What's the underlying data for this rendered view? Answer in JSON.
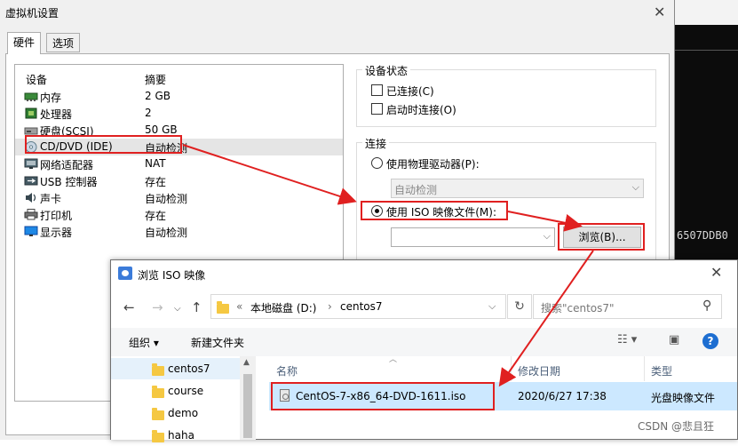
{
  "window": {
    "title": "虚拟机设置"
  },
  "tabs": [
    {
      "label": "硬件"
    },
    {
      "label": "选项"
    }
  ],
  "device_list": {
    "headers": {
      "device": "设备",
      "summary": "摘要"
    },
    "rows": [
      {
        "name": "内存",
        "summary": "2 GB",
        "icon": "memory-icon"
      },
      {
        "name": "处理器",
        "summary": "2",
        "icon": "cpu-icon"
      },
      {
        "name": "硬盘(SCSI)",
        "summary": "50 GB",
        "icon": "harddisk-icon"
      },
      {
        "name": "CD/DVD (IDE)",
        "summary": "自动检测",
        "icon": "cdrom-icon"
      },
      {
        "name": "网络适配器",
        "summary": "NAT",
        "icon": "network-icon"
      },
      {
        "name": "USB 控制器",
        "summary": "存在",
        "icon": "usb-icon"
      },
      {
        "name": "声卡",
        "summary": "自动检测",
        "icon": "sound-icon"
      },
      {
        "name": "打印机",
        "summary": "存在",
        "icon": "printer-icon"
      },
      {
        "name": "显示器",
        "summary": "自动检测",
        "icon": "display-icon"
      }
    ],
    "selected": "CD/DVD (IDE)"
  },
  "device_status": {
    "label": "设备状态",
    "connected": "已连接(C)",
    "connect_at_power_on": "启动时连接(O)"
  },
  "connection": {
    "label": "连接",
    "physical_drive": "使用物理驱动器(P):",
    "physical_drive_value": "自动检测",
    "iso_image": "使用 ISO 映像文件(M):",
    "iso_path_value": "",
    "browse_button": "浏览(B)..."
  },
  "browse_dialog": {
    "title": "浏览 ISO 映像",
    "path": {
      "prefix": "«",
      "drive": "本地磁盘 (D:)",
      "sep": "›",
      "folder": "centos7"
    },
    "search_placeholder": "搜索\"centos7\"",
    "toolbar": {
      "organize": "组织 ▾",
      "new_folder": "新建文件夹"
    },
    "nav_items": [
      "centos7",
      "course",
      "demo",
      "haha"
    ],
    "columns": {
      "name": "名称",
      "modified": "修改日期",
      "type": "类型"
    },
    "files": [
      {
        "name": "CentOS-7-x86_64-DVD-1611.iso",
        "modified": "2020/6/27 17:38",
        "type": "光盘映像文件"
      }
    ]
  },
  "background_terminal": {
    "text": "6507DDB0"
  },
  "watermark": "CSDN @悲且狂",
  "colors": {
    "annotation_red": "#e02020",
    "selection_blue": "#cce8ff",
    "help_blue": "#1d6ed1"
  }
}
